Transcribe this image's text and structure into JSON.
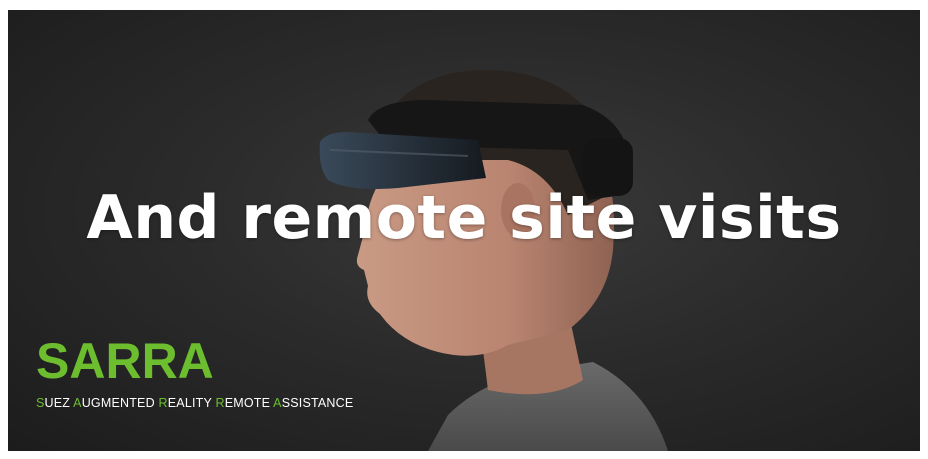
{
  "slide": {
    "headline": "And remote site visits"
  },
  "logo": {
    "name": "SARRA",
    "tagline_words": [
      {
        "initial": "S",
        "rest": "UEZ"
      },
      {
        "initial": "A",
        "rest": "UGMENTED"
      },
      {
        "initial": "R",
        "rest": "EALITY"
      },
      {
        "initial": "R",
        "rest": "EMOTE"
      },
      {
        "initial": "A",
        "rest": "SSISTANCE"
      }
    ],
    "accent_color": "#6dbe2e"
  },
  "image": {
    "subject": "person-wearing-mixed-reality-headset"
  }
}
